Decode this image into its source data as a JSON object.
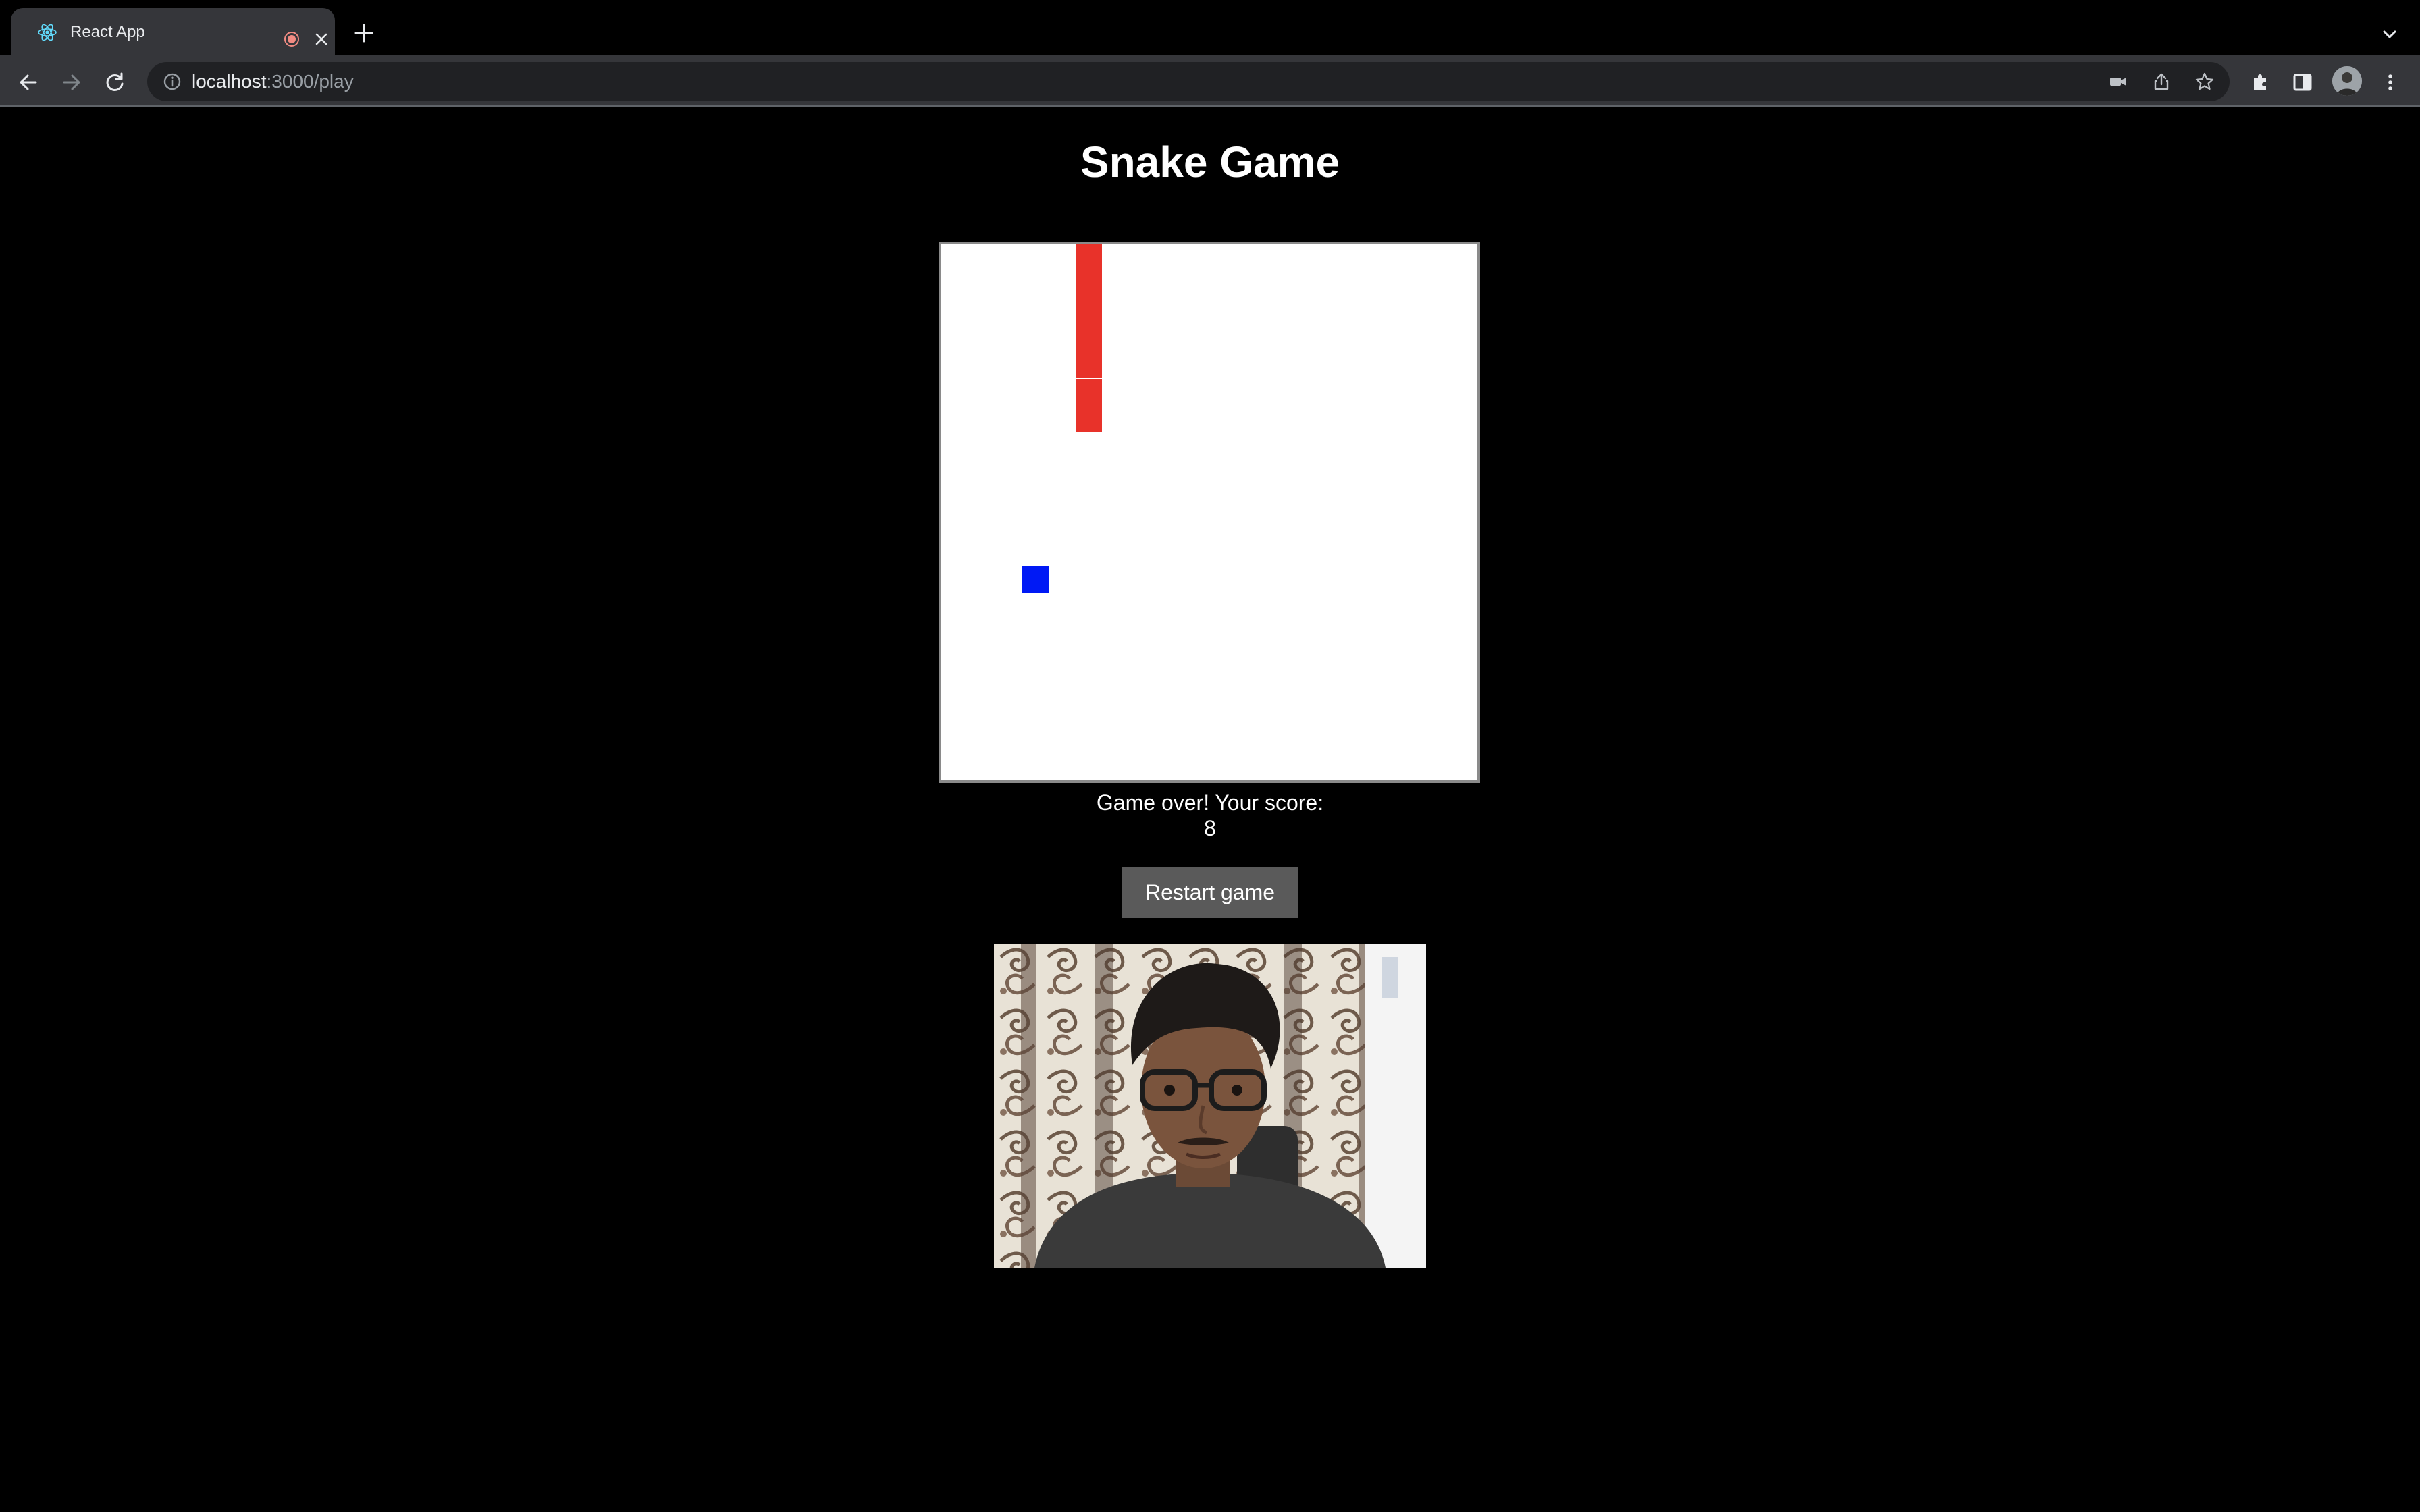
{
  "browser": {
    "tab": {
      "title": "React App",
      "favicon": "react-logo-icon",
      "recording": true
    },
    "address": {
      "host": "localhost",
      "rest": ":3000/play"
    },
    "icons": [
      "back-arrow-icon",
      "forward-arrow-icon",
      "reload-icon",
      "site-info-icon",
      "camera-icon",
      "share-icon",
      "bookmark-star-icon",
      "extensions-icon",
      "side-panel-icon",
      "profile-avatar",
      "kebab-menu-icon"
    ]
  },
  "game": {
    "title": "Snake Game",
    "status_line1": "Game over! Your score:",
    "score": "8",
    "restart_label": "Restart game",
    "grid": {
      "cols": 20,
      "rows": 20
    },
    "snake": [
      [
        5,
        0
      ],
      [
        5,
        1
      ],
      [
        5,
        2
      ],
      [
        5,
        3
      ],
      [
        5,
        4
      ],
      [
        5,
        5
      ],
      [
        5,
        6
      ]
    ],
    "food": [
      3,
      12
    ],
    "colors": {
      "snake": "#e8322a",
      "food": "#0019f5",
      "board": "#ffffff",
      "background": "#000000"
    }
  },
  "webcam": {
    "label": "webcam-feed"
  }
}
